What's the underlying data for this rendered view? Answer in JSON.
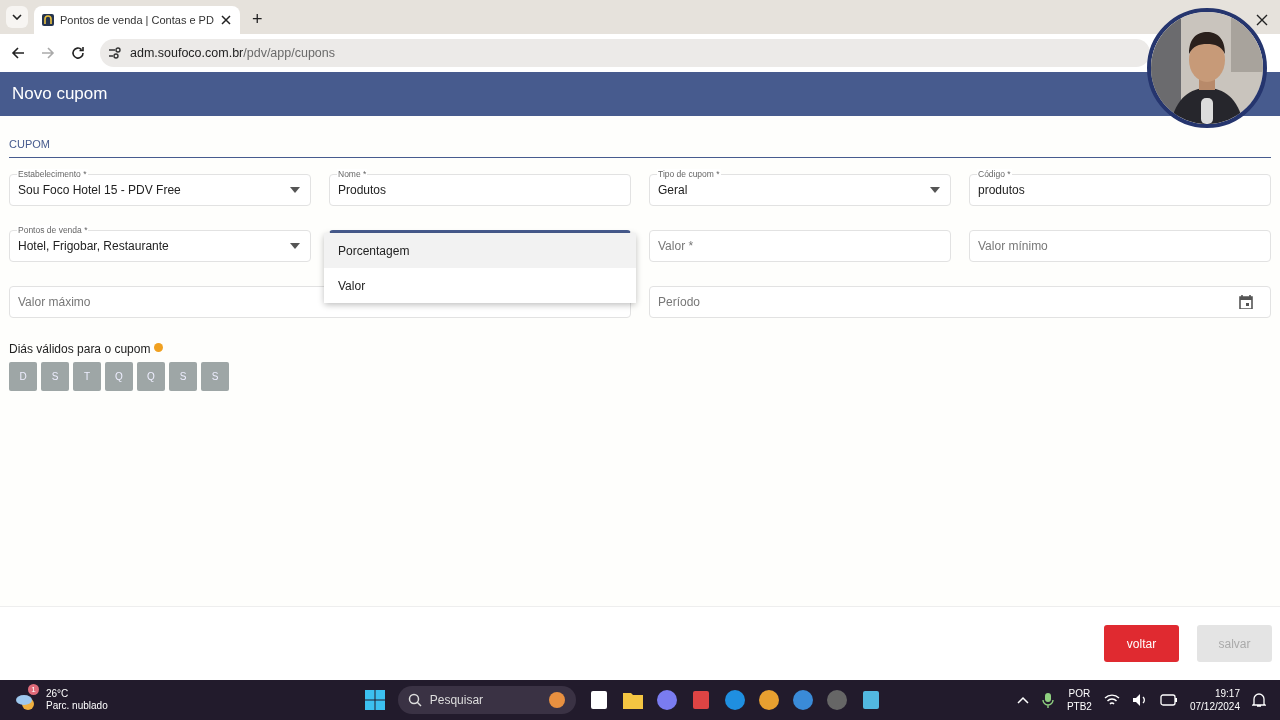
{
  "browser": {
    "tabs": [
      {
        "title": "Pontos de venda | Contas e PD",
        "selected": true
      }
    ],
    "new_tab": "+",
    "url_domain": "adm.soufoco.com.br",
    "url_path": "/pdv/app/cupons"
  },
  "header": {
    "title": "Novo cupom"
  },
  "section": {
    "title": "CUPOM"
  },
  "rows": [
    [
      {
        "kind": "select",
        "label": "Estabelecimento *",
        "value": "Sou Foco Hotel 15 - PDV Free"
      },
      {
        "kind": "text",
        "label": "Nome *",
        "value": "Produtos"
      },
      {
        "kind": "select",
        "label": "Tipo de cupom *",
        "value": "Geral"
      },
      {
        "kind": "text",
        "label": "Código *",
        "value": "produtos"
      }
    ],
    [
      {
        "kind": "select",
        "label": "Pontos de venda *",
        "value": "Hotel, Frigobar, Restaurante"
      },
      {
        "kind": "select",
        "focused": true
      },
      {
        "kind": "text",
        "placeholder": "Valor *"
      },
      {
        "kind": "text",
        "placeholder": "Valor mínimo"
      }
    ],
    [
      {
        "kind": "text",
        "placeholder": "Valor máximo"
      },
      {
        "kind": "date",
        "placeholder": "Período"
      }
    ]
  ],
  "dropdown": {
    "options": [
      {
        "label": "Porcentagem",
        "hovered": true
      },
      {
        "label": "Valor",
        "hovered": false
      }
    ]
  },
  "days": {
    "label": "Diás válidos para o cupom",
    "items": [
      {
        "label": "D",
        "selected": false
      },
      {
        "label": "S",
        "selected": false
      },
      {
        "label": "T",
        "selected": false
      },
      {
        "label": "Q",
        "selected": false
      },
      {
        "label": "Q",
        "selected": false
      },
      {
        "label": "S",
        "selected": false
      },
      {
        "label": "S",
        "selected": false
      }
    ]
  },
  "buttons": [
    {
      "kind": "back",
      "label": "voltar",
      "disabled": false
    },
    {
      "kind": "save",
      "label": "salvar",
      "disabled": true
    }
  ],
  "taskbar": {
    "weather": {
      "temp": "26°C",
      "desc": "Parc. nublado",
      "badge": "1"
    },
    "search": {
      "placeholder": "Pesquisar"
    },
    "tray": {
      "lang": "POR",
      "layout": "PTB2",
      "time": "19:17",
      "date": "07/12/2024"
    }
  }
}
